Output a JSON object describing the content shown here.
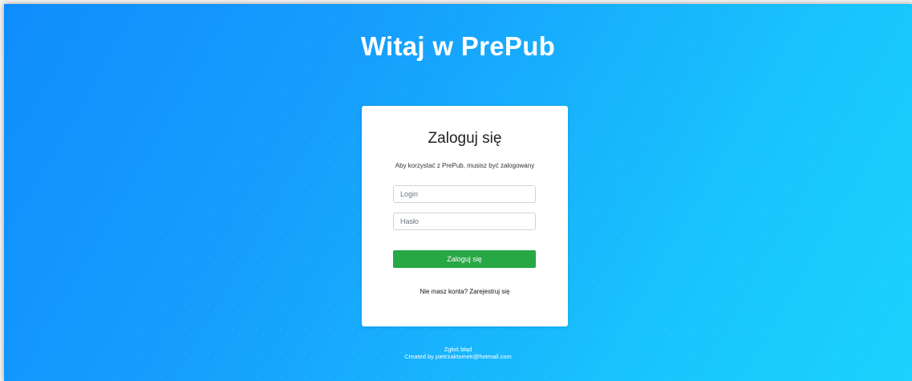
{
  "header": {
    "title": "Witaj w PrePub"
  },
  "login_card": {
    "title": "Zaloguj się",
    "subtitle": "Aby korzystać z PrePub, musisz być zalogowany",
    "login_placeholder": "Login",
    "login_value": "",
    "password_placeholder": "Hasło",
    "password_value": "",
    "submit_label": "Zaloguj się",
    "register_prompt": "Nie masz konta?",
    "register_link": "Zarejestruj się"
  },
  "footer": {
    "report_bug": "Zgłoś błąd",
    "credit": "Created by pietrzaktomek@hotmail.com"
  },
  "colors": {
    "background_start": "#0f8dfd",
    "background_end": "#1ad2fd",
    "submit_button": "#28a745",
    "card": "#ffffff"
  }
}
